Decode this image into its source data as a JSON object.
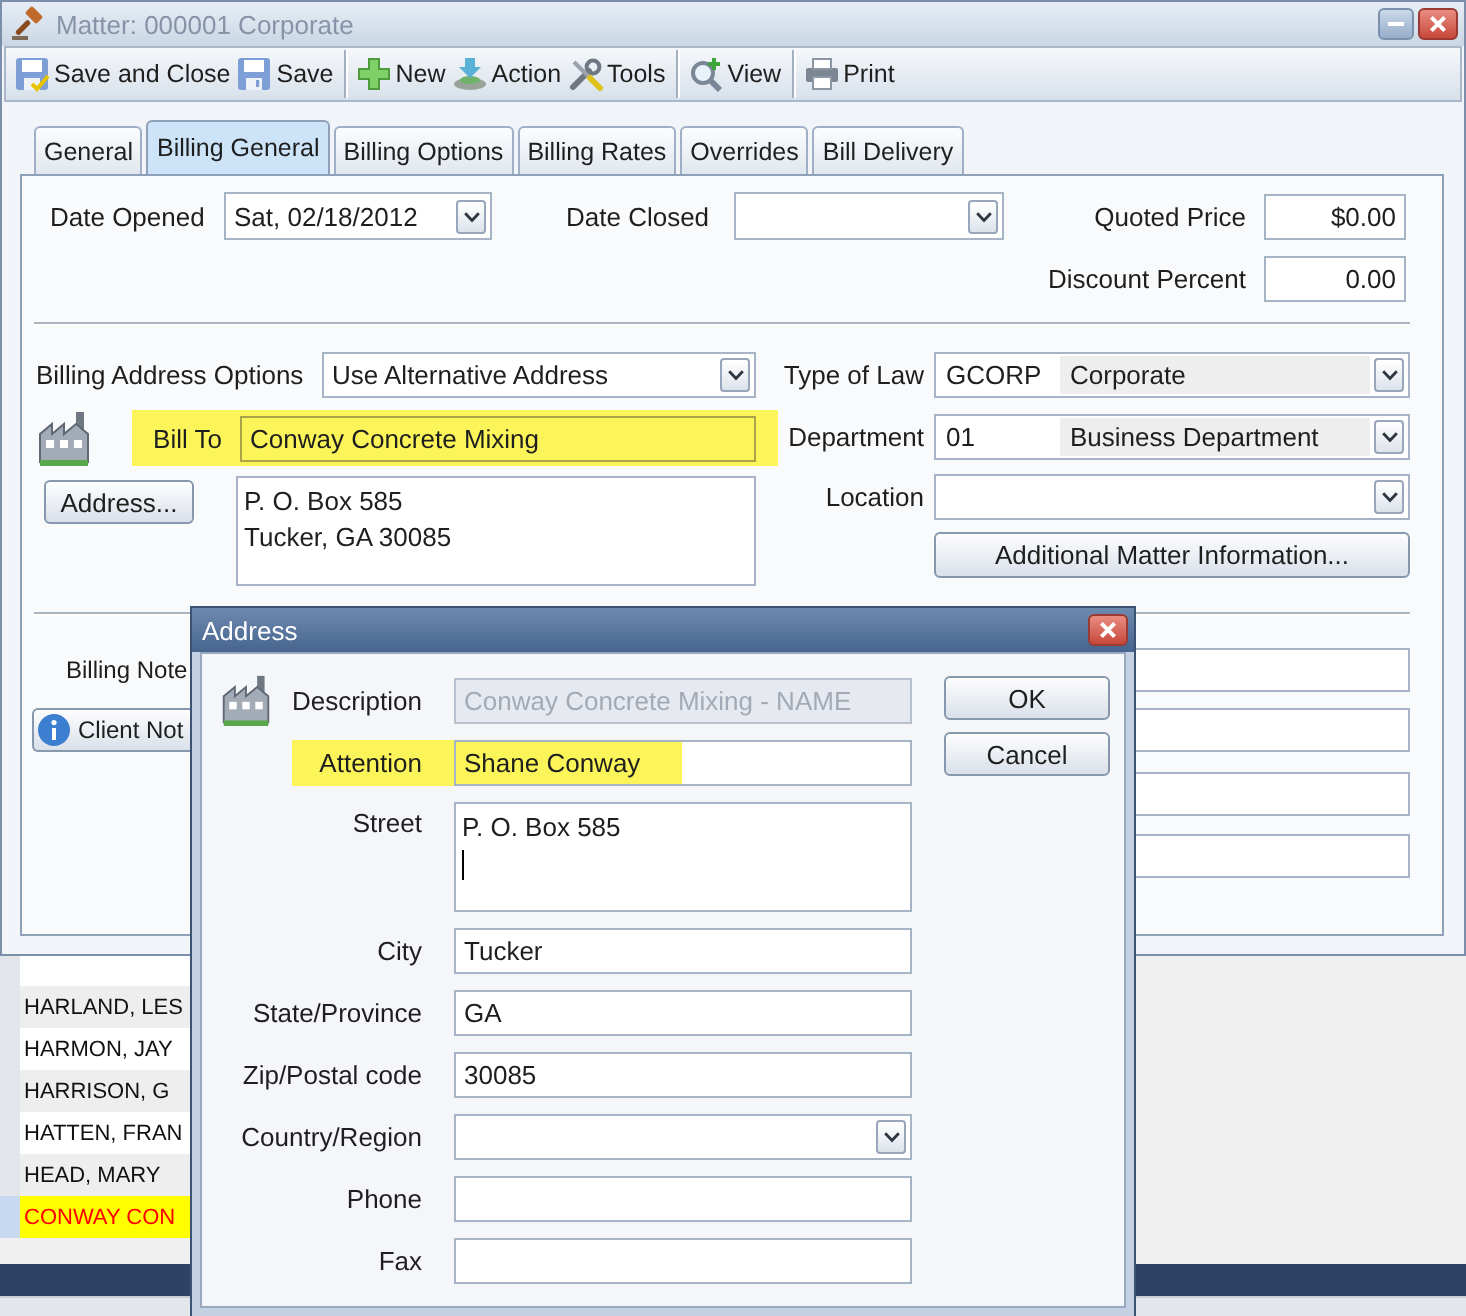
{
  "matter_window": {
    "title": "Matter: 000001 Corporate",
    "active": false,
    "window_buttons": [
      {
        "kind": "minimize"
      },
      {
        "kind": "close"
      }
    ],
    "toolbar": [
      {
        "kind": "save_close",
        "label": "Save and Close"
      },
      {
        "kind": "save",
        "label": "Save"
      },
      {
        "kind": "separator"
      },
      {
        "kind": "new",
        "label": "New"
      },
      {
        "kind": "action",
        "label": "Action"
      },
      {
        "kind": "tools",
        "label": "Tools"
      },
      {
        "kind": "separator"
      },
      {
        "kind": "view",
        "label": "View"
      },
      {
        "kind": "separator"
      },
      {
        "kind": "print",
        "label": "Print"
      }
    ],
    "tabs": [
      {
        "label": "General",
        "selected": false
      },
      {
        "label": "Billing General",
        "selected": true
      },
      {
        "label": "Billing Options",
        "selected": false
      },
      {
        "label": "Billing Rates",
        "selected": false
      },
      {
        "label": "Overrides",
        "selected": false
      },
      {
        "label": "Bill Delivery",
        "selected": false
      }
    ],
    "billing_general": {
      "date_opened": {
        "label": "Date Opened",
        "value": "Sat, 02/18/2012"
      },
      "date_closed": {
        "label": "Date Closed"
      },
      "quoted_price": {
        "label": "Quoted Price",
        "value": "$0.00"
      },
      "discount_percent": {
        "label": "Discount Percent",
        "value": "0.00"
      },
      "billing_address_options": {
        "label": "Billing Address Options",
        "value": "Use Alternative Address"
      },
      "bill_to": {
        "label": "Bill To",
        "value": "Conway Concrete Mixing",
        "highlighted": true
      },
      "address_button": "Address...",
      "address_lines": [
        "P. O. Box 585",
        "Tucker, GA 30085"
      ],
      "type_of_law": {
        "label": "Type of Law",
        "code": "GCORP",
        "description": "Corporate"
      },
      "department": {
        "label": "Department",
        "code": "01",
        "description": "Business Department"
      },
      "location": {
        "label": "Location"
      },
      "additional_info_button": "Additional Matter Information...",
      "billing_notes_label": "Billing Note",
      "client_notes_button": "Client Not"
    }
  },
  "client_list": {
    "rows": [
      {
        "name": "HARLAND, LES",
        "selected": false
      },
      {
        "name": "HARMON, JAY",
        "selected": false
      },
      {
        "name": "HARRISON, G",
        "selected": false
      },
      {
        "name": "HATTEN, FRAN",
        "selected": false
      },
      {
        "name": "HEAD, MARY",
        "selected": false
      },
      {
        "name": "CONWAY CON",
        "selected": true
      }
    ]
  },
  "address_dialog": {
    "title": "Address",
    "active": true,
    "window_buttons": [
      {
        "kind": "close"
      }
    ],
    "fields": [
      {
        "kind": "text",
        "label": "Description",
        "value": "Conway Concrete Mixing - NAME",
        "disabled": true,
        "highlighted": false,
        "focused": false
      },
      {
        "kind": "text",
        "label": "Attention",
        "value": "Shane Conway",
        "disabled": false,
        "highlighted": true,
        "focused": false
      },
      {
        "kind": "multiline",
        "label": "Street",
        "value": "P. O. Box 585",
        "disabled": false,
        "highlighted": false,
        "focused": true
      },
      {
        "kind": "text",
        "label": "City",
        "value": "Tucker",
        "disabled": false,
        "highlighted": false,
        "focused": false
      },
      {
        "kind": "text",
        "label": "State/Province",
        "value": "GA",
        "disabled": false,
        "highlighted": false,
        "focused": false
      },
      {
        "kind": "text",
        "label": "Zip/Postal code",
        "value": "30085",
        "disabled": false,
        "highlighted": false,
        "focused": false
      },
      {
        "kind": "dropdown",
        "label": "Country/Region",
        "disabled": false,
        "highlighted": false,
        "focused": false
      },
      {
        "kind": "text",
        "label": "Phone",
        "disabled": false,
        "highlighted": false,
        "focused": false
      },
      {
        "kind": "text",
        "label": "Fax",
        "disabled": false,
        "highlighted": false,
        "focused": false
      }
    ],
    "buttons": [
      "OK",
      "Cancel"
    ]
  }
}
